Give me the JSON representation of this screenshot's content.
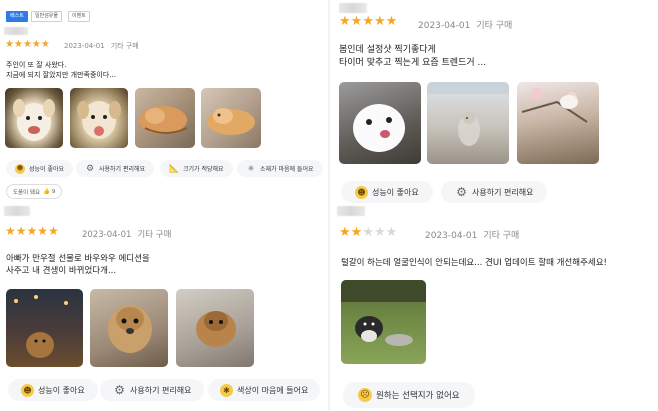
{
  "review1": {
    "tags": [
      "베스트",
      "일반상품 (image is cut here, original reads '일반섬유물')",
      "이벤트"
    ],
    "date": "2023-04-01",
    "purchase": "기타 구매",
    "lines": [
      "주인이 또 잘 사왔다.",
      "지금에 되지 잘았지만 개만족중이다..."
    ],
    "chips": [
      "성능이 좋아요",
      "사용하기 편리해요",
      "크기가 적당해요",
      "소재가 마음에 들어요"
    ],
    "helpful_label": "도움이 돼요",
    "helpful_count": "9",
    "rating": 5
  },
  "review2": {
    "date": "2023-04-01",
    "purchase": "기타 구매",
    "lines": [
      "봄인데 설정샷 찍기좋다게",
      "타이머 맞추고 찍는게 요즘 트렌드거 ..."
    ],
    "chips": [
      "성능이 좋아요",
      "사용하기 편리해요"
    ],
    "rating": 5
  },
  "review3": {
    "date": "2023-04-01",
    "purchase": "기타 구매",
    "lines": [
      "아빠가 만우절 선물로 바우와우 에디션을",
      "사주고 내 견생이 바뀌었다개..."
    ],
    "chips": [
      "성능이 좋아요",
      "사용하기 편리해요",
      "색상이 마음에 들어요"
    ],
    "rating": 5
  },
  "review4": {
    "date": "2023-04-01",
    "purchase": "기타 구매",
    "lines": [
      "털갈이 하는데 얼굴인식이 안되는데요... 견UI 업데이트 할때 개선해주세요!"
    ],
    "chips": [
      "원하는 선택지가 없어요"
    ],
    "rating": 2
  },
  "icons": {
    "chip_good": "smile-face-icon",
    "chip_easy": "gear-icon",
    "chip_size": "ruler-icon",
    "chip_material": "sparkle-icon",
    "chip_color": "palette-icon",
    "chip_none": "neutral-face-icon",
    "star": "star-icon"
  },
  "colors": {
    "star": "#f5a623",
    "star_off": "#d9d9d9",
    "tag_blue": "#2f7ae5",
    "chip_bg": "#f5f6f8"
  }
}
